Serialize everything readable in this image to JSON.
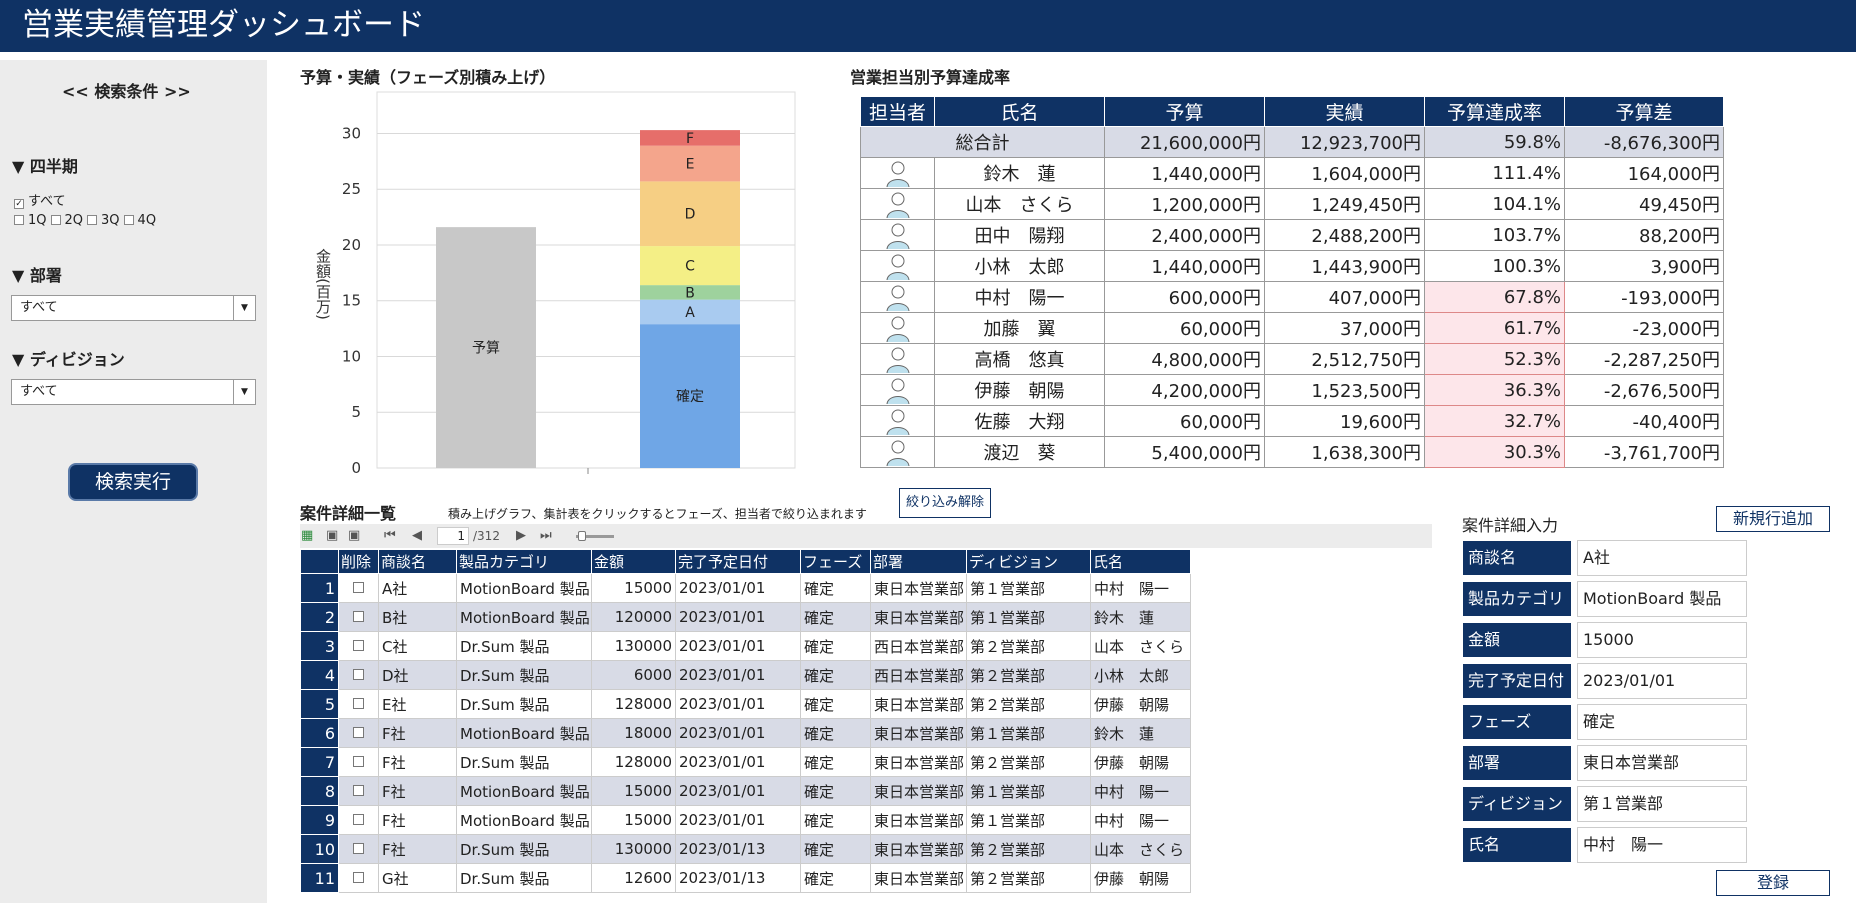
{
  "header": {
    "title": "営業実績管理ダッシュボード"
  },
  "sidebar": {
    "heading": "<< 検索条件 >>",
    "quarter": {
      "label": "▼ 四半期",
      "all": "すべて",
      "q1": "1Q",
      "q2": "2Q",
      "q3": "3Q",
      "q4": "4Q"
    },
    "department": {
      "label": "▼ 部署",
      "value": "すべて"
    },
    "division": {
      "label": "▼ ディビジョン",
      "value": "すべて"
    },
    "search_button": "検索実行"
  },
  "chart_section": {
    "title": "予算・実績（フェーズ別積み上げ）"
  },
  "chart_data": {
    "type": "bar",
    "title": "予算・実績（フェーズ別積み上げ）",
    "ylabel": "金額(百万)",
    "ylim": [
      0,
      33
    ],
    "yticks": [
      "0",
      "5",
      "10",
      "15",
      "20",
      "25",
      "30"
    ],
    "grid": true,
    "budget": {
      "label": "予算",
      "value": 21.6,
      "color": "#c8c8c8"
    },
    "actual_stack": [
      {
        "label": "確定",
        "value": 12.9,
        "color": "#6fa6e6"
      },
      {
        "label": "A",
        "value": 2.2,
        "color": "#a9cbf0"
      },
      {
        "label": "B",
        "value": 1.3,
        "color": "#9ed29d"
      },
      {
        "label": "C",
        "value": 3.5,
        "color": "#f4ef86"
      },
      {
        "label": "D",
        "value": 5.8,
        "color": "#f6cf84"
      },
      {
        "label": "E",
        "value": 3.2,
        "color": "#f4a58c"
      },
      {
        "label": "F",
        "value": 1.4,
        "color": "#e66e6a"
      }
    ]
  },
  "rep_section": {
    "title": "営業担当別予算達成率",
    "headers": [
      "担当者",
      "氏名",
      "予算",
      "実績",
      "予算達成率",
      "予算差"
    ],
    "total": {
      "label": "総合計",
      "budget": "21,600,000円",
      "actual": "12,923,700円",
      "rate": "59.8%",
      "diff": "-8,676,300円"
    },
    "rows": [
      {
        "name": "鈴木　蓮",
        "budget": "1,440,000円",
        "actual": "1,604,000円",
        "rate": "111.4%",
        "diff": "164,000円"
      },
      {
        "name": "山本　さくら",
        "budget": "1,200,000円",
        "actual": "1,249,450円",
        "rate": "104.1%",
        "diff": "49,450円"
      },
      {
        "name": "田中　陽翔",
        "budget": "2,400,000円",
        "actual": "2,488,200円",
        "rate": "103.7%",
        "diff": "88,200円"
      },
      {
        "name": "小林　太郎",
        "budget": "1,440,000円",
        "actual": "1,443,900円",
        "rate": "100.3%",
        "diff": "3,900円"
      },
      {
        "name": "中村　陽一",
        "budget": "600,000円",
        "actual": "407,000円",
        "rate": "67.8%",
        "diff": "-193,000円"
      },
      {
        "name": "加藤　翼",
        "budget": "60,000円",
        "actual": "37,000円",
        "rate": "61.7%",
        "diff": "-23,000円"
      },
      {
        "name": "高橋　悠真",
        "budget": "4,800,000円",
        "actual": "2,512,750円",
        "rate": "52.3%",
        "diff": "-2,287,250円"
      },
      {
        "name": "伊藤　朝陽",
        "budget": "4,200,000円",
        "actual": "1,523,500円",
        "rate": "36.3%",
        "diff": "-2,676,500円"
      },
      {
        "name": "佐藤　大翔",
        "budget": "60,000円",
        "actual": "19,600円",
        "rate": "32.7%",
        "diff": "-40,400円"
      },
      {
        "name": "渡辺　葵",
        "budget": "5,400,000円",
        "actual": "1,638,300円",
        "rate": "30.3%",
        "diff": "-3,761,700円"
      }
    ]
  },
  "detail_section": {
    "title": "案件詳細一覧",
    "hint": "積み上げグラフ、集計表をクリックするとフェーズ、担当者で絞り込まれます",
    "clear_filter_button": "絞り込み解除",
    "pager": {
      "page": "1",
      "total": "/312"
    },
    "headers": [
      "削除",
      "商談名",
      "製品カテゴリ",
      "金額",
      "完了予定日付",
      "フェーズ",
      "部署",
      "ディビジョン",
      "氏名"
    ],
    "rows": [
      {
        "no": "1",
        "deal": "A社",
        "category": "MotionBoard 製品",
        "amount": "15000",
        "date": "2023/01/01",
        "phase": "確定",
        "dept": "東日本営業部",
        "division": "第１営業部",
        "name": "中村　陽一"
      },
      {
        "no": "2",
        "deal": "B社",
        "category": "MotionBoard 製品",
        "amount": "120000",
        "date": "2023/01/01",
        "phase": "確定",
        "dept": "東日本営業部",
        "division": "第１営業部",
        "name": "鈴木　蓮"
      },
      {
        "no": "3",
        "deal": "C社",
        "category": "Dr.Sum 製品",
        "amount": "130000",
        "date": "2023/01/01",
        "phase": "確定",
        "dept": "西日本営業部",
        "division": "第２営業部",
        "name": "山本　さくら"
      },
      {
        "no": "4",
        "deal": "D社",
        "category": "Dr.Sum 製品",
        "amount": "6000",
        "date": "2023/01/01",
        "phase": "確定",
        "dept": "西日本営業部",
        "division": "第２営業部",
        "name": "小林　太郎"
      },
      {
        "no": "5",
        "deal": "E社",
        "category": "Dr.Sum 製品",
        "amount": "128000",
        "date": "2023/01/01",
        "phase": "確定",
        "dept": "東日本営業部",
        "division": "第２営業部",
        "name": "伊藤　朝陽"
      },
      {
        "no": "6",
        "deal": "F社",
        "category": "MotionBoard 製品",
        "amount": "18000",
        "date": "2023/01/01",
        "phase": "確定",
        "dept": "東日本営業部",
        "division": "第１営業部",
        "name": "鈴木　蓮"
      },
      {
        "no": "7",
        "deal": "F社",
        "category": "Dr.Sum 製品",
        "amount": "128000",
        "date": "2023/01/01",
        "phase": "確定",
        "dept": "東日本営業部",
        "division": "第２営業部",
        "name": "伊藤　朝陽"
      },
      {
        "no": "8",
        "deal": "F社",
        "category": "MotionBoard 製品",
        "amount": "15000",
        "date": "2023/01/01",
        "phase": "確定",
        "dept": "東日本営業部",
        "division": "第１営業部",
        "name": "中村　陽一"
      },
      {
        "no": "9",
        "deal": "F社",
        "category": "MotionBoard 製品",
        "amount": "15000",
        "date": "2023/01/01",
        "phase": "確定",
        "dept": "東日本営業部",
        "division": "第１営業部",
        "name": "中村　陽一"
      },
      {
        "no": "10",
        "deal": "F社",
        "category": "Dr.Sum 製品",
        "amount": "130000",
        "date": "2023/01/13",
        "phase": "確定",
        "dept": "東日本営業部",
        "division": "第２営業部",
        "name": "山本　さくら"
      },
      {
        "no": "11",
        "deal": "G社",
        "category": "Dr.Sum 製品",
        "amount": "12600",
        "date": "2023/01/13",
        "phase": "確定",
        "dept": "東日本営業部",
        "division": "第２営業部",
        "name": "伊藤　朝陽"
      }
    ]
  },
  "form": {
    "title": "案件詳細入力",
    "new_button": "新規行追加",
    "register_button": "登録",
    "fields": [
      {
        "label": "商談名",
        "value": "A社"
      },
      {
        "label": "製品カテゴリ",
        "value": "MotionBoard 製品"
      },
      {
        "label": "金額",
        "value": "15000"
      },
      {
        "label": "完了予定日付",
        "value": "2023/01/01"
      },
      {
        "label": "フェーズ",
        "value": "確定"
      },
      {
        "label": "部署",
        "value": "東日本営業部"
      },
      {
        "label": "ディビジョン",
        "value": "第１営業部"
      },
      {
        "label": "氏名",
        "value": "中村　陽一"
      }
    ]
  }
}
